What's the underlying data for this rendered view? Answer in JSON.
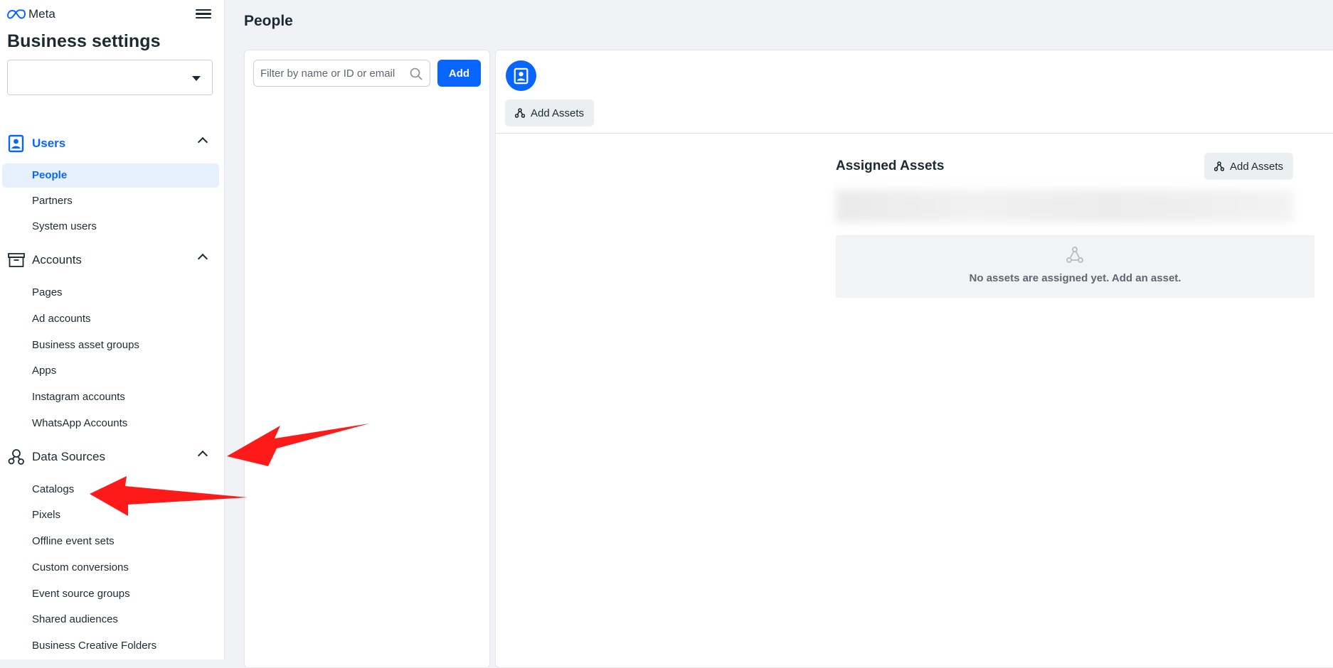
{
  "sidebar": {
    "logo": "Meta",
    "title": "Business settings",
    "business_select_value": "",
    "sections": [
      {
        "label": "Users",
        "icon": "users-icon",
        "items": [
          "People",
          "Partners",
          "System users"
        ]
      },
      {
        "label": "Accounts",
        "icon": "accounts-icon",
        "items": [
          "Pages",
          "Ad accounts",
          "Business asset groups",
          "Apps",
          "Instagram accounts",
          "WhatsApp Accounts"
        ]
      },
      {
        "label": "Data Sources",
        "icon": "data-sources-icon",
        "items": [
          "Catalogs",
          "Pixels",
          "Offline event sets",
          "Custom conversions",
          "Event source groups",
          "Shared audiences",
          "Business Creative Folders"
        ]
      }
    ],
    "selected_item": "People"
  },
  "main": {
    "page_title": "People",
    "search": {
      "placeholder": "Filter by name or ID or email",
      "value": ""
    },
    "add_label": "Add",
    "detail": {
      "add_assets_label": "Add Assets",
      "assigned_title": "Assigned Assets",
      "assigned_add_label": "Add Assets",
      "empty_text": "No assets are assigned yet. Add an asset."
    }
  },
  "colors": {
    "accent": "#0866ff",
    "selected_bg": "#e7f0fd",
    "page_bg": "#f0f2f5",
    "annotation_arrow": "#ff1a1a"
  }
}
